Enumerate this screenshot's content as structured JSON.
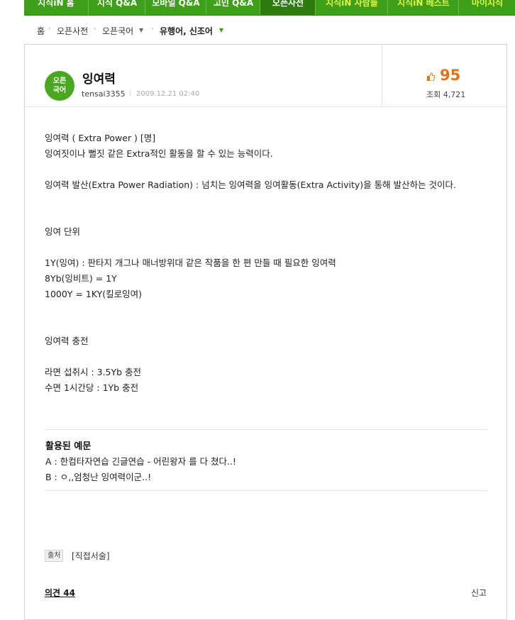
{
  "topnav": {
    "tabs": [
      {
        "label": "지식iN 홈",
        "active": false,
        "highlight": false
      },
      {
        "label": "지식 Q&A",
        "active": false,
        "highlight": false
      },
      {
        "label": "모바일 Q&A",
        "active": false,
        "highlight": false
      },
      {
        "label": "고민 Q&A",
        "active": false,
        "highlight": false
      },
      {
        "label": "오픈사전",
        "active": true,
        "highlight": false
      },
      {
        "label": "지식iN 사람들",
        "active": false,
        "highlight": true
      },
      {
        "label": "지식iN 베스트",
        "active": false,
        "highlight": true
      },
      {
        "label": "마이지식",
        "active": false,
        "highlight": true
      }
    ]
  },
  "breadcrumb": {
    "home": "홈",
    "dict": "오픈사전",
    "lang": "오픈국어",
    "current": "유행어, 신조어"
  },
  "entry": {
    "badge_line1": "오픈",
    "badge_line2": "국어",
    "title": "잉여력",
    "author": "tensai3355",
    "date": "2009.12.21 02:40",
    "recommend_count": "95",
    "views_label": "조회",
    "views_count": "4,721"
  },
  "body": {
    "lines": [
      "잉여력 ( Extra Power ) [명]",
      "잉여짓이나 뻘짓 같은 Extra적인 활동을 할 수 있는 능력이다.",
      "잉여력 발산(Extra Power Radiation) : 넘치는 잉여력을 잉여활동(Extra Activity)을 통해 발산하는 것이다.",
      "잉여 단위",
      "1Y(잉여) : 판타지 개그나 매너방위대 같은 작품을 한 편 만들 때 필요한 잉여력",
      "8Yb(잉비트) = 1Y",
      "1000Y = 1KY(킬로잉여)",
      "잉여력 충전",
      "라면 섭취시 : 3.5Yb 충전",
      "수면 1시간당 : 1Yb 충전"
    ]
  },
  "examples": {
    "title": "활용된 예문",
    "a": "A : 한컴타자연습 긴글연습 - 어린왕자 를 다 쳤다..!",
    "b": "B : ㅇ,,엄청난 잉여력이군..!"
  },
  "source": {
    "tag": "출처",
    "text": "[직접서술]"
  },
  "footer": {
    "opinions": "의견 44",
    "report": "신고"
  }
}
